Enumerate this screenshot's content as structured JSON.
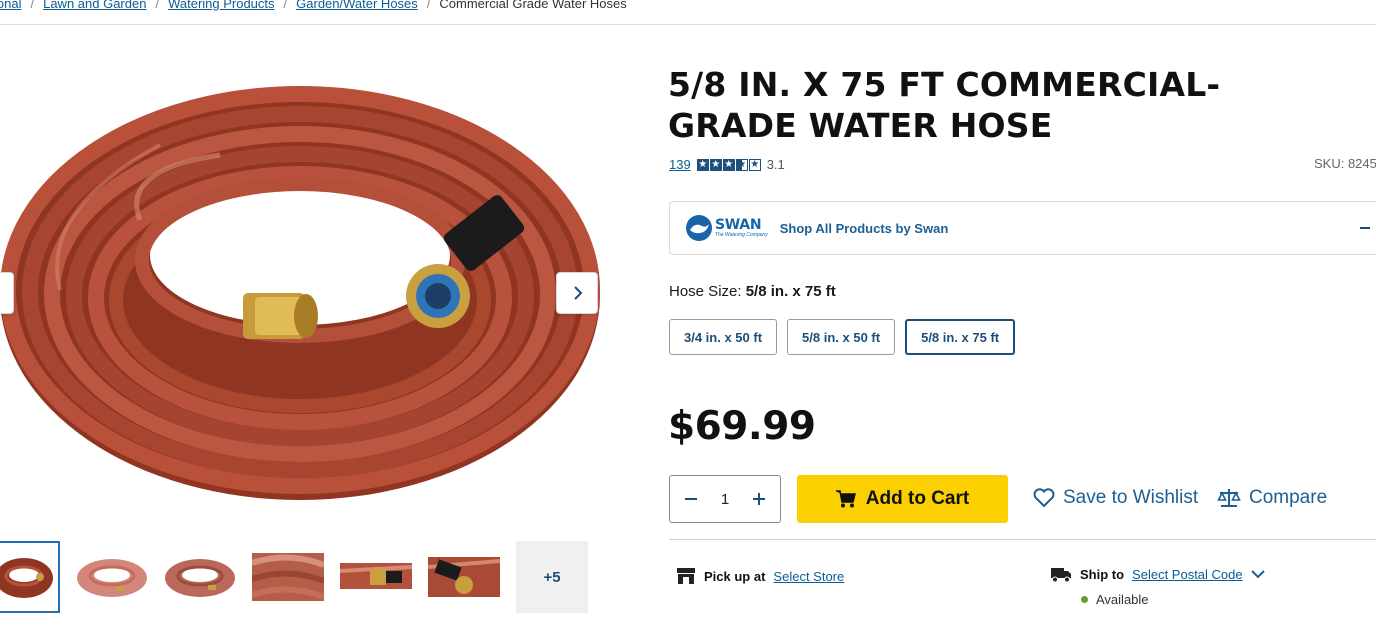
{
  "breadcrumb": {
    "items": [
      "ional",
      "Lawn and Garden",
      "Watering Products",
      "Garden/Water Hoses"
    ],
    "current": "Commercial Grade Water Hoses"
  },
  "product": {
    "title": "5/8 in. x 75 ft Commercial-Grade Water Hose",
    "rating_count": "139",
    "rating_value": "3.1",
    "rating_stars": 3.1,
    "sku": "SKU: 8245"
  },
  "brand": {
    "logo_text": "SWAN",
    "logo_tagline": "The Watering Company",
    "link": "Shop All Products by Swan"
  },
  "size": {
    "label": "Hose Size:",
    "selected_value": "5/8 in. x 75 ft",
    "options": [
      "3/4 in. x 50 ft",
      "5/8 in. x 50 ft",
      "5/8 in. x 75 ft"
    ]
  },
  "price": "$69.99",
  "quantity": "1",
  "actions": {
    "add_to_cart": "Add to Cart",
    "wishlist": "Save to Wishlist",
    "compare": "Compare"
  },
  "fulfillment": {
    "pickup_label": "Pick up at",
    "pickup_link": "Select Store",
    "ship_label": "Ship to",
    "ship_link": "Select Postal Code",
    "availability": "Available"
  },
  "gallery": {
    "more_label": "+5"
  },
  "colors": {
    "hose": "#a8402a",
    "brand_blue": "#1d4e7a",
    "add_to_cart": "#fcd000",
    "available": "#6a9a1f"
  }
}
